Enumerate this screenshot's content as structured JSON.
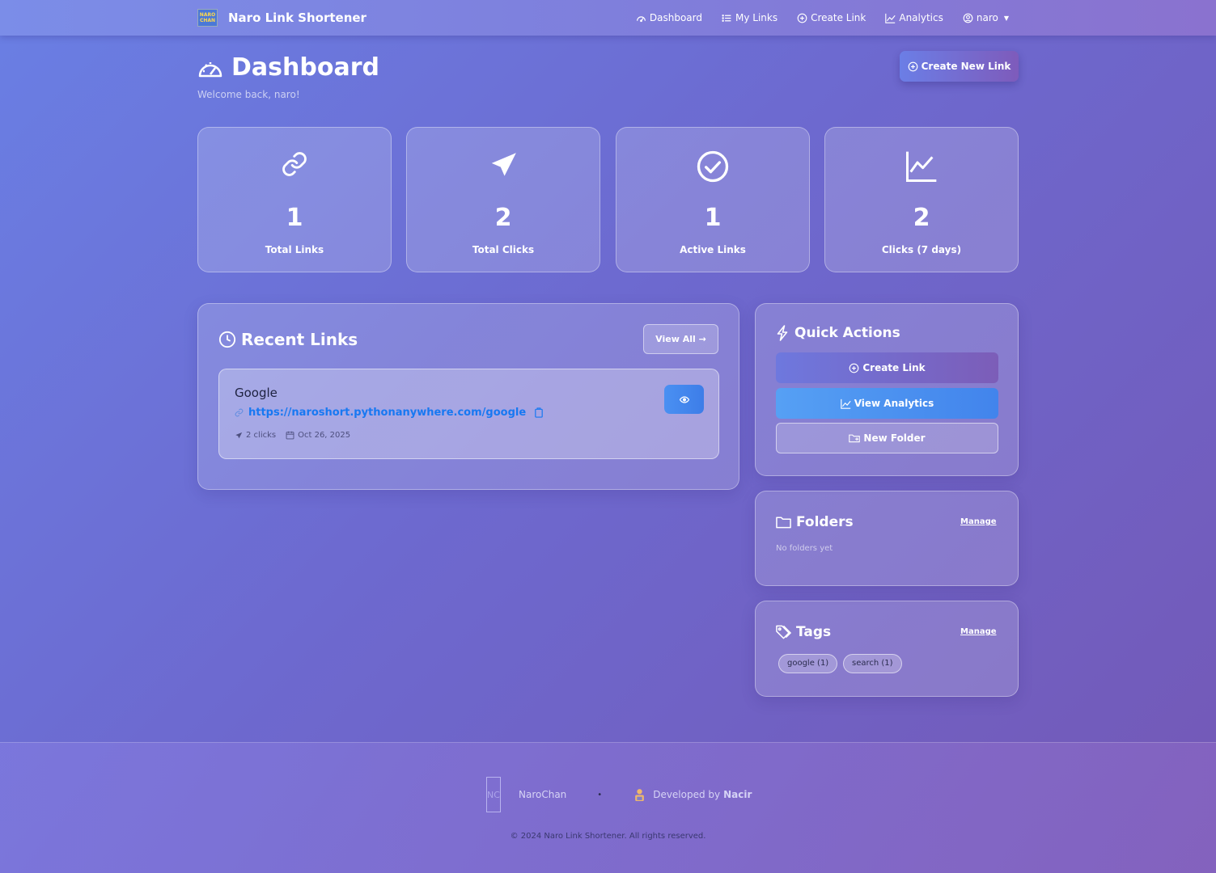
{
  "navbar": {
    "brand_logo_text": "NARO CHAN",
    "brand_name": "Naro Link Shortener",
    "links": [
      {
        "label": "Dashboard",
        "icon": "speedometer-icon"
      },
      {
        "label": "My Links",
        "icon": "list-icon"
      },
      {
        "label": "Create Link",
        "icon": "plus-circle-icon"
      },
      {
        "label": "Analytics",
        "icon": "chart-line-icon"
      }
    ],
    "user": {
      "label": "naro",
      "icon": "user-circle-icon"
    }
  },
  "header": {
    "title": "Dashboard",
    "welcome": "Welcome back, naro!",
    "create_button": "Create New Link"
  },
  "stats": [
    {
      "value": "1",
      "label": "Total Links",
      "icon": "link-icon"
    },
    {
      "value": "2",
      "label": "Total Clicks",
      "icon": "send-icon"
    },
    {
      "value": "1",
      "label": "Active Links",
      "icon": "check-circle-icon"
    },
    {
      "value": "2",
      "label": "Clicks (7 days)",
      "icon": "graph-up-icon"
    }
  ],
  "recent_links": {
    "title": "Recent Links",
    "view_all": "View All →",
    "items": [
      {
        "title": "Google",
        "url": "https://naroshort.pythonanywhere.com/google",
        "clicks": "2 clicks",
        "date": "Oct 26, 2025"
      }
    ]
  },
  "quick_actions": {
    "title": "Quick Actions",
    "create_link": "Create Link",
    "view_analytics": "View Analytics",
    "new_folder": "New Folder"
  },
  "folders": {
    "title": "Folders",
    "manage": "Manage",
    "empty": "No folders yet"
  },
  "tags": {
    "title": "Tags",
    "manage": "Manage",
    "items": [
      "google (1)",
      "search (1)"
    ]
  },
  "footer": {
    "logo_text": "NC",
    "brand": "NaroChan",
    "separator": "•",
    "developed_by": "Developed by",
    "developer": "Nacir",
    "copyright": "© 2024 Naro Link Shortener. All rights reserved."
  },
  "colors": {
    "accent_blue": "#1778f2",
    "primary_button": "#4a90f2"
  }
}
